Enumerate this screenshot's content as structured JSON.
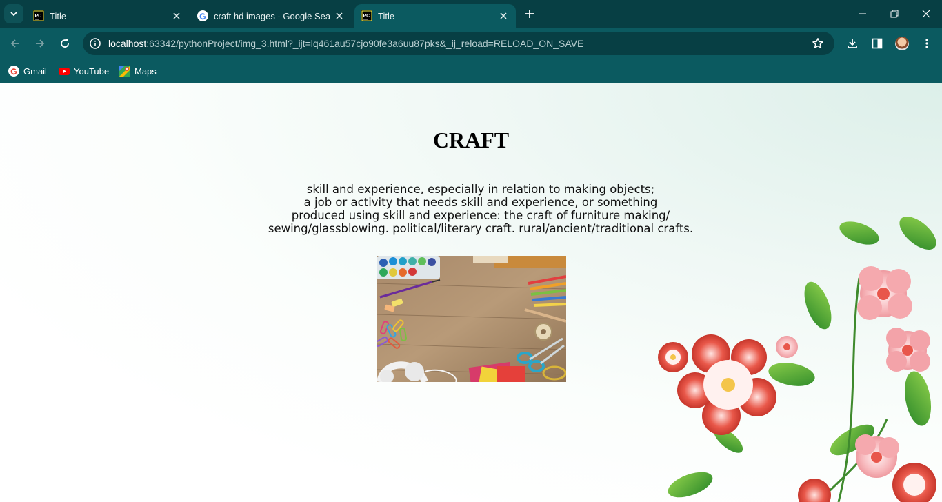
{
  "browser": {
    "tabs": [
      {
        "title": "Title",
        "favicon": "pycharm-icon",
        "active": false
      },
      {
        "title": "craft hd images - Google Search",
        "favicon": "google-icon",
        "active": false
      },
      {
        "title": "Title",
        "favicon": "pycharm-icon",
        "active": true
      }
    ],
    "address_bar": {
      "host": "localhost",
      "path": ":63342/pythonProject/img_3.html?_ijt=lq461au57cjo90fe3a6uu87pks&_ij_reload=RELOAD_ON_SAVE"
    },
    "bookmarks": [
      {
        "label": "Gmail",
        "icon": "gmail-icon"
      },
      {
        "label": "YouTube",
        "icon": "youtube-icon"
      },
      {
        "label": "Maps",
        "icon": "maps-icon"
      }
    ],
    "colors": {
      "frame": "#073f44",
      "toolbar": "#0b5a60"
    }
  },
  "page": {
    "heading": "CRAFT",
    "definition_lines": [
      "skill and experience, especially in relation to making objects;",
      "a job or activity that needs skill and experience, or something",
      "produced using skill and experience: the craft of furniture making/",
      "sewing/glassblowing. political/literary craft. rural/ancient/traditional crafts."
    ]
  }
}
